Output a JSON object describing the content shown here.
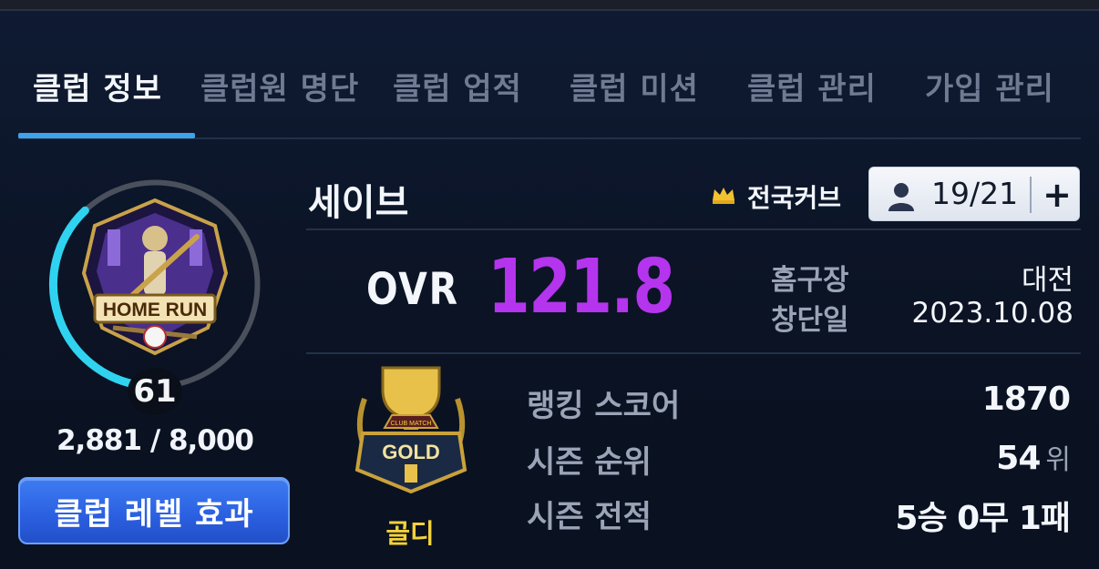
{
  "tabs": [
    {
      "label": "클럽 정보",
      "active": true
    },
    {
      "label": "클럽원 명단",
      "active": false
    },
    {
      "label": "클럽 업적",
      "active": false
    },
    {
      "label": "클럽 미션",
      "active": false
    },
    {
      "label": "클럽 관리",
      "active": false
    },
    {
      "label": "가입 관리",
      "active": false
    }
  ],
  "club": {
    "emblem_text": "HOME RUN",
    "level": "61",
    "exp_text": "2,881 / 8,000",
    "exp_progress": 0.36,
    "level_button_label": "클럽 레벨 효과",
    "name": "세이브",
    "league_icon": "crown-icon",
    "league_name": "전국커브",
    "member_icon": "person-icon",
    "members": "19/21",
    "add_member_label": "+"
  },
  "stats": {
    "ovr_label": "OVR",
    "ovr_value": "121.8",
    "home_label": "홈구장",
    "home_value": "대전",
    "founded_label": "창단일",
    "founded_value": "2023.10.08"
  },
  "tier": {
    "emblem_text": "GOLD",
    "emblem_small_text": "CLUB MATCH",
    "name": "골디"
  },
  "ranking": {
    "score_label": "랭킹 스코어",
    "score_value": "1870",
    "rank_label": "시즌 순위",
    "rank_value": "54",
    "rank_unit": "위",
    "record_label": "시즌 전적",
    "record_value": "5승 0무 1패"
  },
  "colors": {
    "accent_blue": "#3fa3ea",
    "ovr_purple": "#b534ee",
    "tier_gold": "#f2d23b",
    "ring_cyan": "#2fd3ef"
  }
}
